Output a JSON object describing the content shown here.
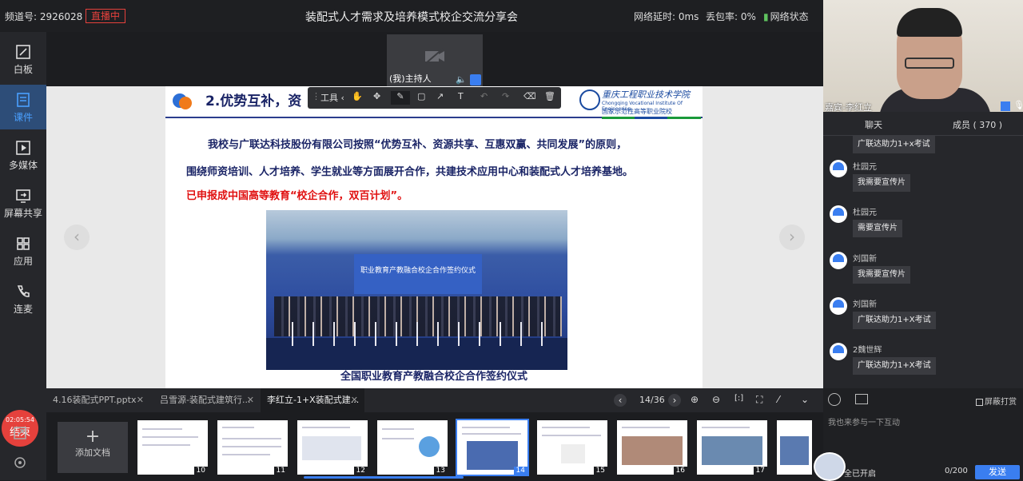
{
  "header": {
    "channel": "频道号: 2926028",
    "live_badge": "直播中",
    "title": "装配式人才需求及培养模式校企交流分享会",
    "net_delay": "网络延时: 0ms",
    "packet_loss": "丢包率: 0%",
    "net_status": "网络状态"
  },
  "sidebar": {
    "items": [
      {
        "label": "白板",
        "icon": "whiteboard-icon"
      },
      {
        "label": "课件",
        "icon": "courseware-icon"
      },
      {
        "label": "多媒体",
        "icon": "media-icon"
      },
      {
        "label": "屏幕共享",
        "icon": "screen-share-icon"
      },
      {
        "label": "应用",
        "icon": "apps-icon"
      },
      {
        "label": "连麦",
        "icon": "phone-icon"
      }
    ],
    "timer": "02:05:54",
    "end_label": "结束"
  },
  "host_video": {
    "label": "(我)主持人"
  },
  "toolbar": {
    "tools_label": "工具"
  },
  "slide": {
    "title": "2.优势互补，资",
    "school_cn": "重庆工程职业技术学院",
    "school_en": "Chongqing Vocational Institute Of Engineering",
    "school_sub": "国家示范性高等职业院校",
    "p1": "我校与广联达科技股份有限公司按照“优势互补、资源共享、互惠双赢、共同发展”的原则，",
    "p2": "围绕师资培训、人才培养、学生就业等方面展开合作，共建技术应用中心和装配式人才培养基地。",
    "p3": "已申报成中国高等教育“校企合作，双百计划”。",
    "photo_text": "职业教育产教融合校企合作签约仪式",
    "caption": "全国职业教育产教融合校企合作签约仪式"
  },
  "tabs": [
    {
      "label": "4.16装配式PPT.pptx"
    },
    {
      "label": "吕雪源-装配式建筑行..."
    },
    {
      "label": "李红立-1+X装配式建..."
    }
  ],
  "pager": "14/36",
  "add_doc": "添加文档",
  "thumbs": [
    "10",
    "11",
    "12",
    "13",
    "14",
    "15",
    "16",
    "17"
  ],
  "user_video": {
    "name": "嘉宾-李红立"
  },
  "right_tabs": {
    "chat": "聊天",
    "members": "成员 ( 370 )"
  },
  "chat": [
    {
      "name": "",
      "text": "广联达助力1+x考试"
    },
    {
      "name": "杜园元",
      "text": "我需要宣传片"
    },
    {
      "name": "杜园元",
      "text": "需要宣传片"
    },
    {
      "name": "刘国新",
      "text": "我需要宣传片"
    },
    {
      "name": "刘国新",
      "text": "广联达助力1+X考试"
    },
    {
      "name": "2魏世辉",
      "text": "广联达助力1+X考试"
    }
  ],
  "input": {
    "block_label": "屏蔽打赏",
    "placeholder": "我也来参与一下互动",
    "all_on": "全已开启",
    "count": "0/200",
    "send": "发送"
  },
  "colors": {
    "accent": "#3a7ef0",
    "live": "#e5413c",
    "active_sidebar": "#2d4d78"
  }
}
